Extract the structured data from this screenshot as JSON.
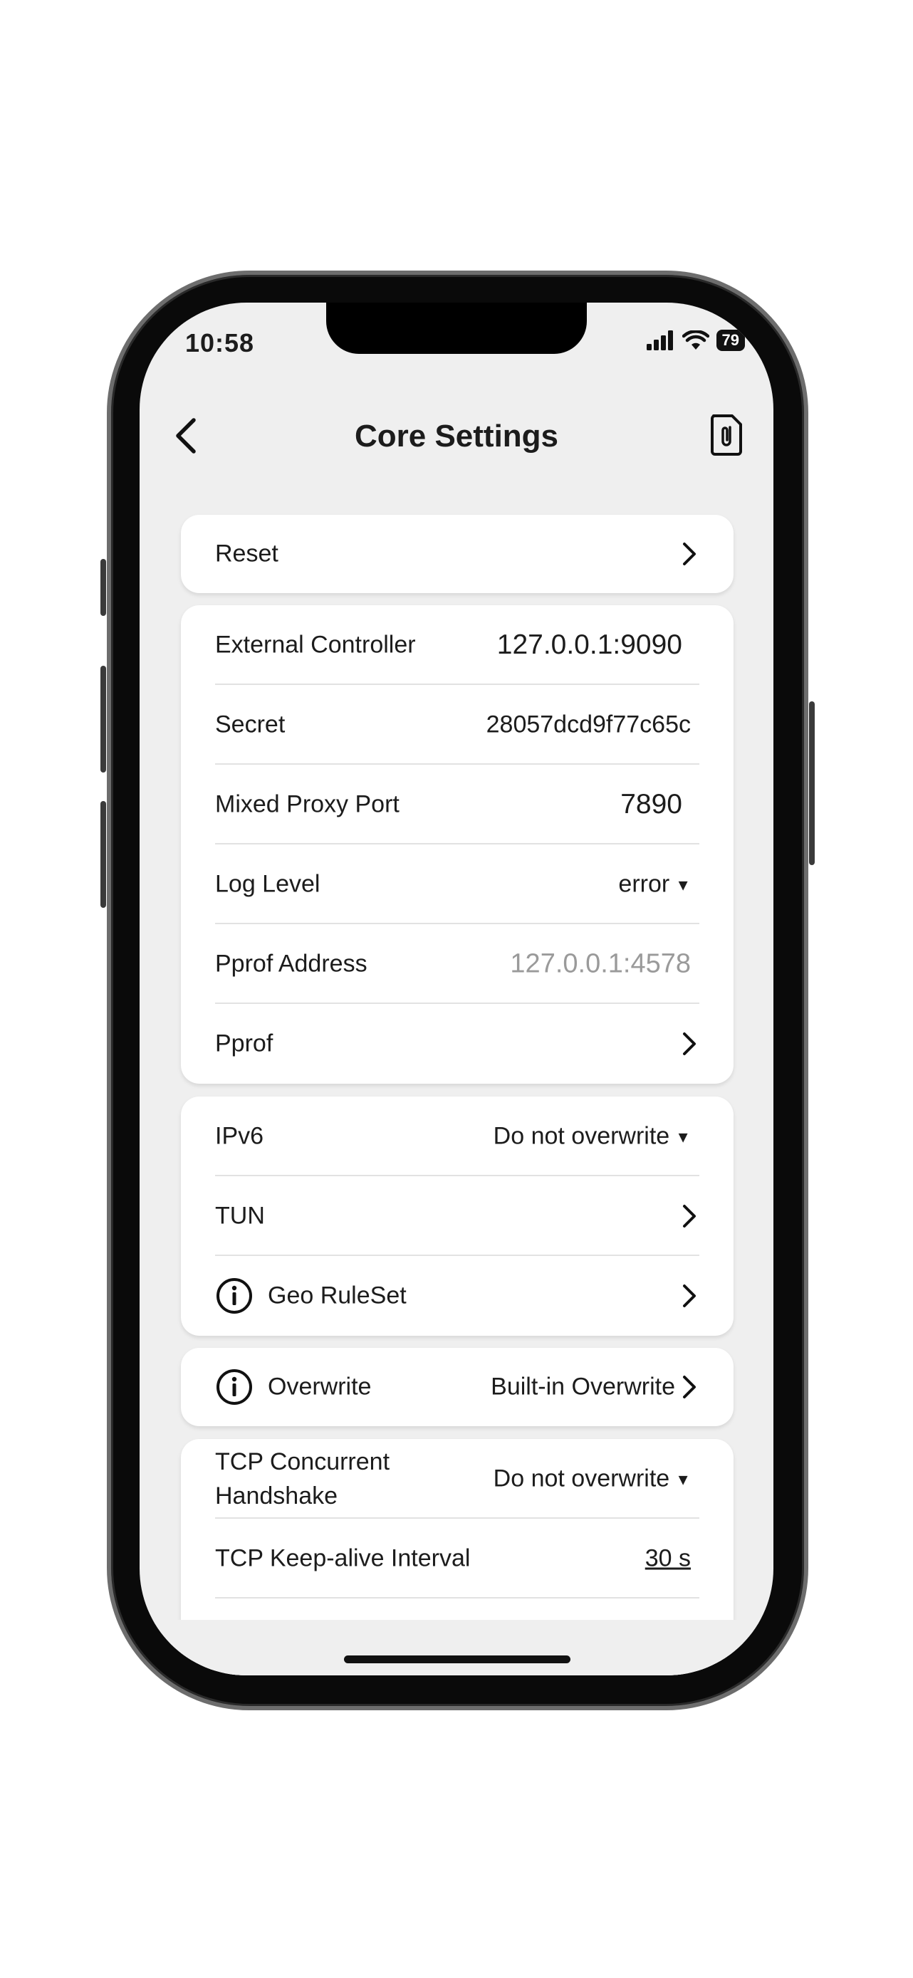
{
  "status": {
    "time": "10:58",
    "battery": "79"
  },
  "header": {
    "title": "Core Settings"
  },
  "reset": {
    "label": "Reset"
  },
  "controller": {
    "external_controller_label": "External Controller",
    "external_controller_value": "127.0.0.1:9090",
    "secret_label": "Secret",
    "secret_value": "28057dcd9f77c65c",
    "mixed_port_label": "Mixed Proxy Port",
    "mixed_port_value": "7890",
    "log_level_label": "Log Level",
    "log_level_value": "error",
    "pprof_address_label": "Pprof Address",
    "pprof_address_placeholder": "127.0.0.1:4578",
    "pprof_label": "Pprof"
  },
  "network": {
    "ipv6_label": "IPv6",
    "ipv6_value": "Do not overwrite",
    "tun_label": "TUN",
    "geo_label": "Geo RuleSet"
  },
  "overwrite": {
    "label": "Overwrite",
    "value": "Built-in Overwrite"
  },
  "tcp": {
    "concurrent_label_line1": "TCP Concurrent",
    "concurrent_label_line2": "Handshake",
    "concurrent_value": "Do not overwrite",
    "keepalive_label": "TCP Keep-alive Interval",
    "keepalive_value": "30 s"
  }
}
